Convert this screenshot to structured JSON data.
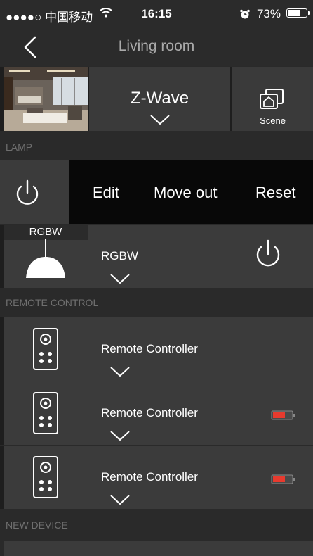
{
  "status_bar": {
    "carrier": "●●●●○ 中国移动",
    "wifi": "wifi-icon",
    "time": "16:15",
    "alarm": "alarm-clock-icon",
    "battery_text": "73%",
    "battery_level": 0.73
  },
  "nav": {
    "back_icon": "chevron-left-icon",
    "title": "Living room"
  },
  "header": {
    "room_photo": "living-room-photo",
    "protocol_label": "Z-Wave",
    "scene_label": "Scene"
  },
  "sections": {
    "lamp": "LAMP",
    "remote": "REMOTE CONTROL",
    "new_device": "NEW DEVICE"
  },
  "swipe_actions": {
    "power_icon": "power-icon",
    "edit": "Edit",
    "move_out": "Move out",
    "reset": "Reset"
  },
  "lamp_devices": [
    {
      "tag": "RGBW",
      "name": "RGBW",
      "icon": "pendant-lamp-icon"
    }
  ],
  "remote_devices": [
    {
      "name": "Remote Controller",
      "low_battery": false
    },
    {
      "name": "Remote Controller",
      "low_battery": true
    },
    {
      "name": "Remote Controller",
      "low_battery": true
    }
  ],
  "colors": {
    "background": "#2a2a2a",
    "card": "#3b3b3b",
    "low_battery": "#e83a2e",
    "section_text": "#6f6f6f"
  }
}
